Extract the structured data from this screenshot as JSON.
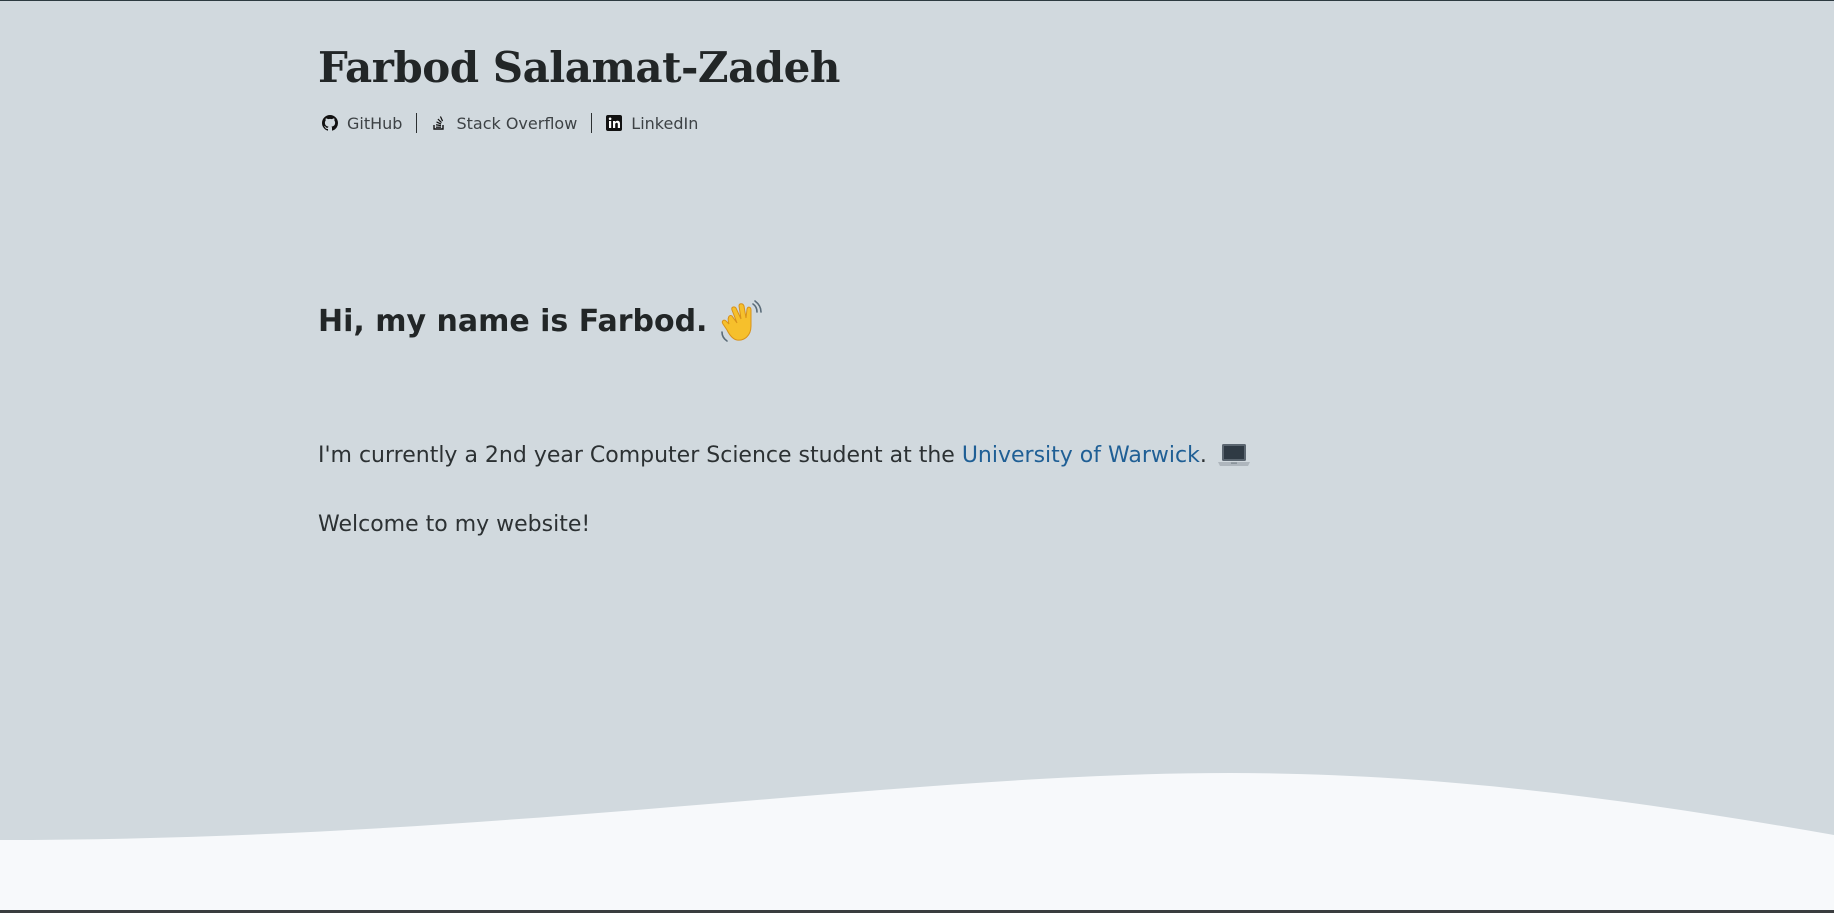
{
  "header": {
    "title": "Farbod Salamat-Zadeh",
    "links": [
      {
        "label": "GitHub",
        "icon": "github-icon"
      },
      {
        "label": "Stack Overflow",
        "icon": "stack-overflow-icon"
      },
      {
        "label": "LinkedIn",
        "icon": "linkedin-icon"
      }
    ]
  },
  "intro": {
    "greeting": "Hi, my name is Farbod.",
    "greeting_icon": "waving-hand-icon",
    "para1_before": "I'm currently a 2nd year Computer Science student at the ",
    "para1_link": "University of Warwick",
    "para1_after": ".",
    "para1_icon": "laptop-icon",
    "para2": "Welcome to my website!"
  },
  "colors": {
    "background": "#d1d9de",
    "wave": "#f7f9fb",
    "link": "#1f5f95",
    "text": "#222627"
  }
}
